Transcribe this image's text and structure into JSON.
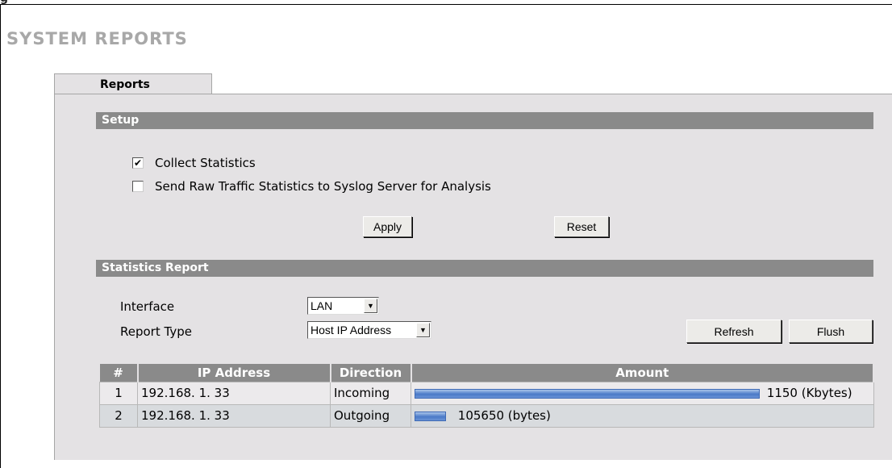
{
  "page": {
    "figure_label": "g",
    "title": "SYSTEM REPORTS",
    "tab": "Reports"
  },
  "setup": {
    "header": "Setup",
    "collect_statistics": {
      "label": "Collect Statistics",
      "checked": true
    },
    "send_raw": {
      "label": "Send Raw Traffic Statistics to Syslog Server for Analysis",
      "checked": false
    },
    "apply_label": "Apply",
    "reset_label": "Reset"
  },
  "stats": {
    "header": "Statistics Report",
    "interface_label": "Interface",
    "interface_value": "LAN",
    "report_type_label": "Report Type",
    "report_type_value": "Host IP Address",
    "refresh_label": "Refresh",
    "flush_label": "Flush"
  },
  "table": {
    "headers": [
      "#",
      "IP Address",
      "Direction",
      "Amount"
    ],
    "rows": [
      {
        "num": "1",
        "ip": "192.168. 1. 33",
        "direction": "Incoming",
        "amount": "1150 (Kbytes)",
        "bar_fraction": 1.0
      },
      {
        "num": "2",
        "ip": "192.168. 1. 33",
        "direction": "Outgoing",
        "amount": "105650 (bytes)",
        "bar_fraction": 0.092
      }
    ]
  },
  "colors": {
    "accent_bar": "#4a79c7",
    "section_header": "#8a8a8a",
    "title_gray": "#a8a8a8"
  }
}
